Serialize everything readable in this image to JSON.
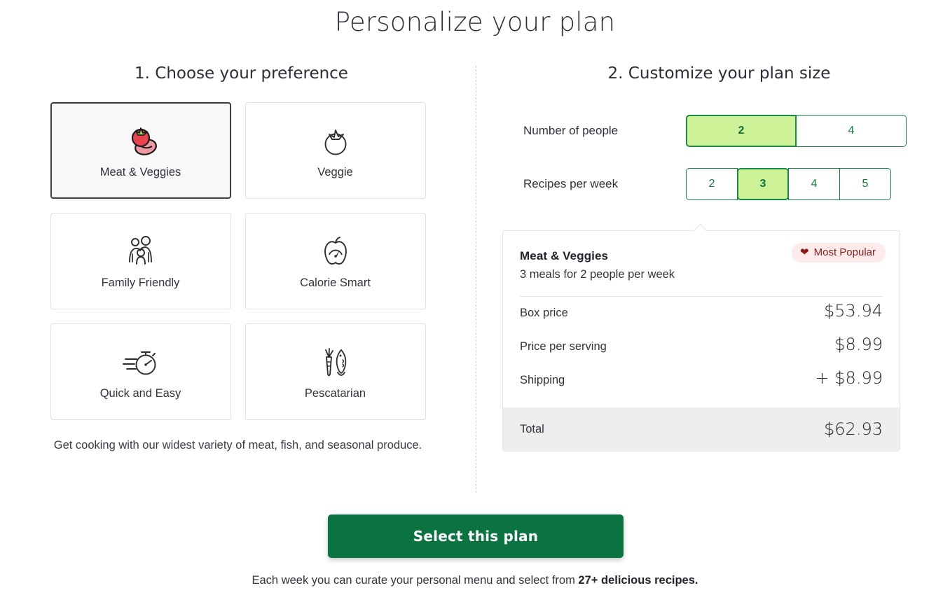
{
  "page": {
    "title": "Personalize your plan"
  },
  "left": {
    "heading": "1. Choose your preference",
    "cards": [
      {
        "label": "Meat & Veggies",
        "icon": "meat-veggies-icon",
        "selected": true
      },
      {
        "label": "Veggie",
        "icon": "tomato-icon",
        "selected": false
      },
      {
        "label": "Family Friendly",
        "icon": "family-icon",
        "selected": false
      },
      {
        "label": "Calorie Smart",
        "icon": "apple-gauge-icon",
        "selected": false
      },
      {
        "label": "Quick and Easy",
        "icon": "stopwatch-icon",
        "selected": false
      },
      {
        "label": "Pescatarian",
        "icon": "carrot-fish-icon",
        "selected": false
      }
    ],
    "description": "Get cooking with our widest variety of meat, fish, and seasonal produce."
  },
  "right": {
    "heading": "2. Customize your plan size",
    "people": {
      "label": "Number of people",
      "options": [
        "2",
        "4"
      ],
      "selected": "2"
    },
    "recipes": {
      "label": "Recipes per week",
      "options": [
        "2",
        "3",
        "4",
        "5"
      ],
      "selected": "3"
    },
    "summary": {
      "plan_name": "Meat & Veggies",
      "plan_subtitle": "3 meals for 2 people per week",
      "badge": {
        "label": "Most Popular",
        "icon": "heart-icon"
      },
      "rows": [
        {
          "label": "Box price",
          "value": "$53.94"
        },
        {
          "label": "Price per serving",
          "value": "$8.99"
        },
        {
          "label": "Shipping",
          "value": "+ $8.99"
        }
      ],
      "total": {
        "label": "Total",
        "value": "$62.93"
      }
    }
  },
  "cta": {
    "label": "Select this plan"
  },
  "footnote": {
    "prefix": "Each week you can curate your personal menu and select from ",
    "bold": "27+ delicious recipes."
  },
  "colors": {
    "brand_green": "#0a7340",
    "selected_green_fill": "#cdf297",
    "selected_green_border": "#1a8a43",
    "badge_bg": "#fdeaea",
    "badge_text": "#8a2323",
    "total_row_bg": "#eeeeee"
  }
}
